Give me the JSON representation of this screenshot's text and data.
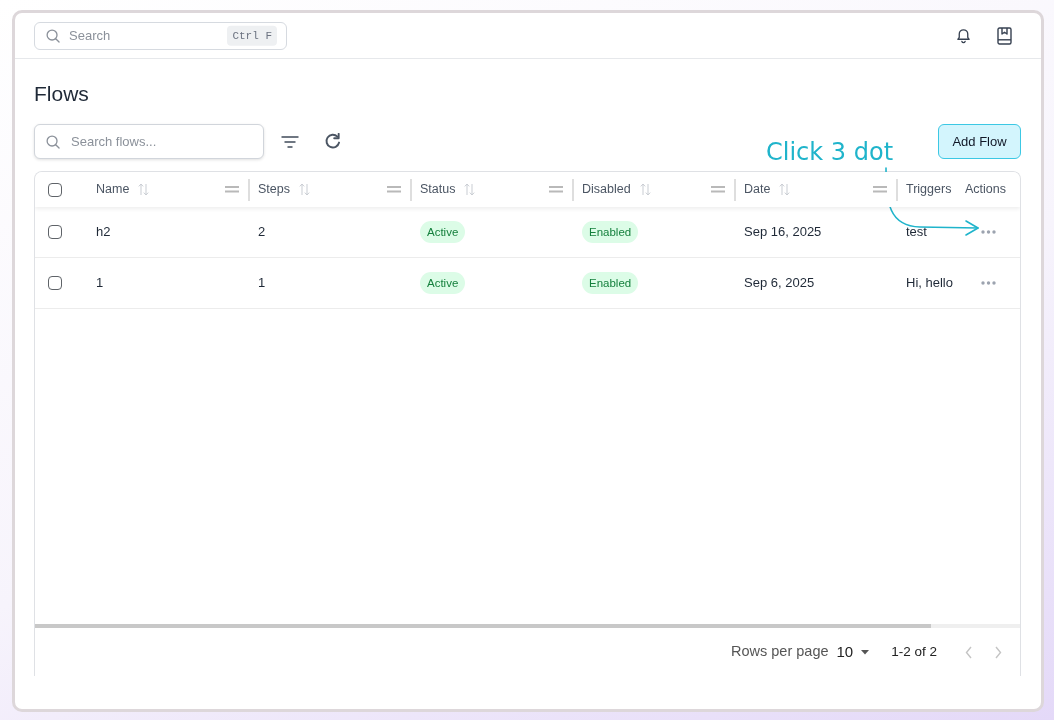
{
  "topbar": {
    "search": {
      "placeholder": "Search",
      "shortcut": "Ctrl F"
    }
  },
  "page": {
    "title": "Flows"
  },
  "toolbar": {
    "search": {
      "placeholder": "Search flows..."
    },
    "add_button": {
      "label": "Add Flow"
    }
  },
  "annotation": {
    "text": "Click 3 dot"
  },
  "table": {
    "select_all": {
      "checked": false
    },
    "columns": [
      {
        "label": "Name",
        "kind": "text",
        "sortable": true,
        "resizable": true
      },
      {
        "label": "Steps",
        "kind": "text",
        "sortable": true,
        "resizable": true
      },
      {
        "label": "Status",
        "kind": "badge",
        "sortable": true,
        "resizable": true
      },
      {
        "label": "Disabled",
        "kind": "badge",
        "sortable": true,
        "resizable": true
      },
      {
        "label": "Date",
        "kind": "text",
        "sortable": true,
        "resizable": true
      },
      {
        "label": "Triggers",
        "kind": "text",
        "sortable": false,
        "resizable": false
      }
    ],
    "actions_column": {
      "label": "Actions"
    },
    "rows": [
      {
        "selected": false,
        "cells": [
          "h2",
          "2",
          "Active",
          "Enabled",
          "Sep 16, 2025",
          "test"
        ]
      },
      {
        "selected": false,
        "cells": [
          "1",
          "1",
          "Active",
          "Enabled",
          "Sep 6, 2025",
          "Hi, hello"
        ]
      }
    ]
  },
  "pagination": {
    "rows_per_page_label": "Rows per page",
    "rows_per_page": "10",
    "range": "1-2 of 2",
    "prev_disabled": true,
    "next_disabled": true
  }
}
